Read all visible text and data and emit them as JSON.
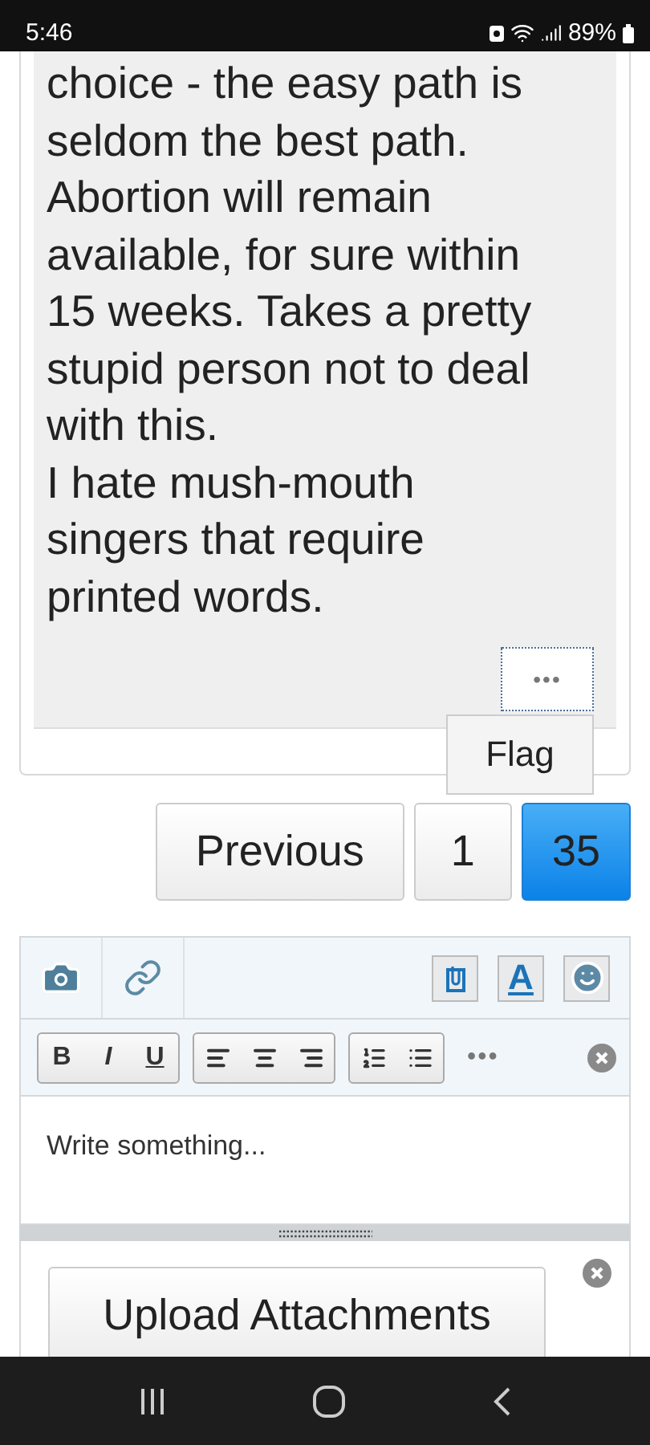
{
  "status_bar": {
    "time": "5:46",
    "battery": "89%"
  },
  "post": {
    "paragraphs": [
      {
        "lines": [
          "choice - the easy path is",
          "seldom the best path.",
          "Abortion will remain",
          "available, for sure within",
          "15 weeks. Takes a pretty",
          "stupid person not to deal",
          "with this."
        ]
      },
      {
        "lines": [
          "I hate mush-mouth",
          "singers that require",
          "printed words."
        ]
      }
    ],
    "more_button": "•••",
    "menu": {
      "open": true,
      "items": [
        "Flag"
      ]
    }
  },
  "pagination": [
    {
      "label": "Previous",
      "selected": false
    },
    {
      "label": "1",
      "selected": false
    },
    {
      "label": "35",
      "selected": true
    }
  ],
  "editor": {
    "text_color_button": "A",
    "format_buttons": [
      {
        "label": "B",
        "kind": "bold"
      },
      {
        "label": "I",
        "kind": "italic"
      },
      {
        "label": "U",
        "kind": "underline"
      }
    ],
    "more_button": "•••",
    "placeholder": "Write something..."
  },
  "attachments": {
    "upload_button": "Upload Attachments"
  }
}
